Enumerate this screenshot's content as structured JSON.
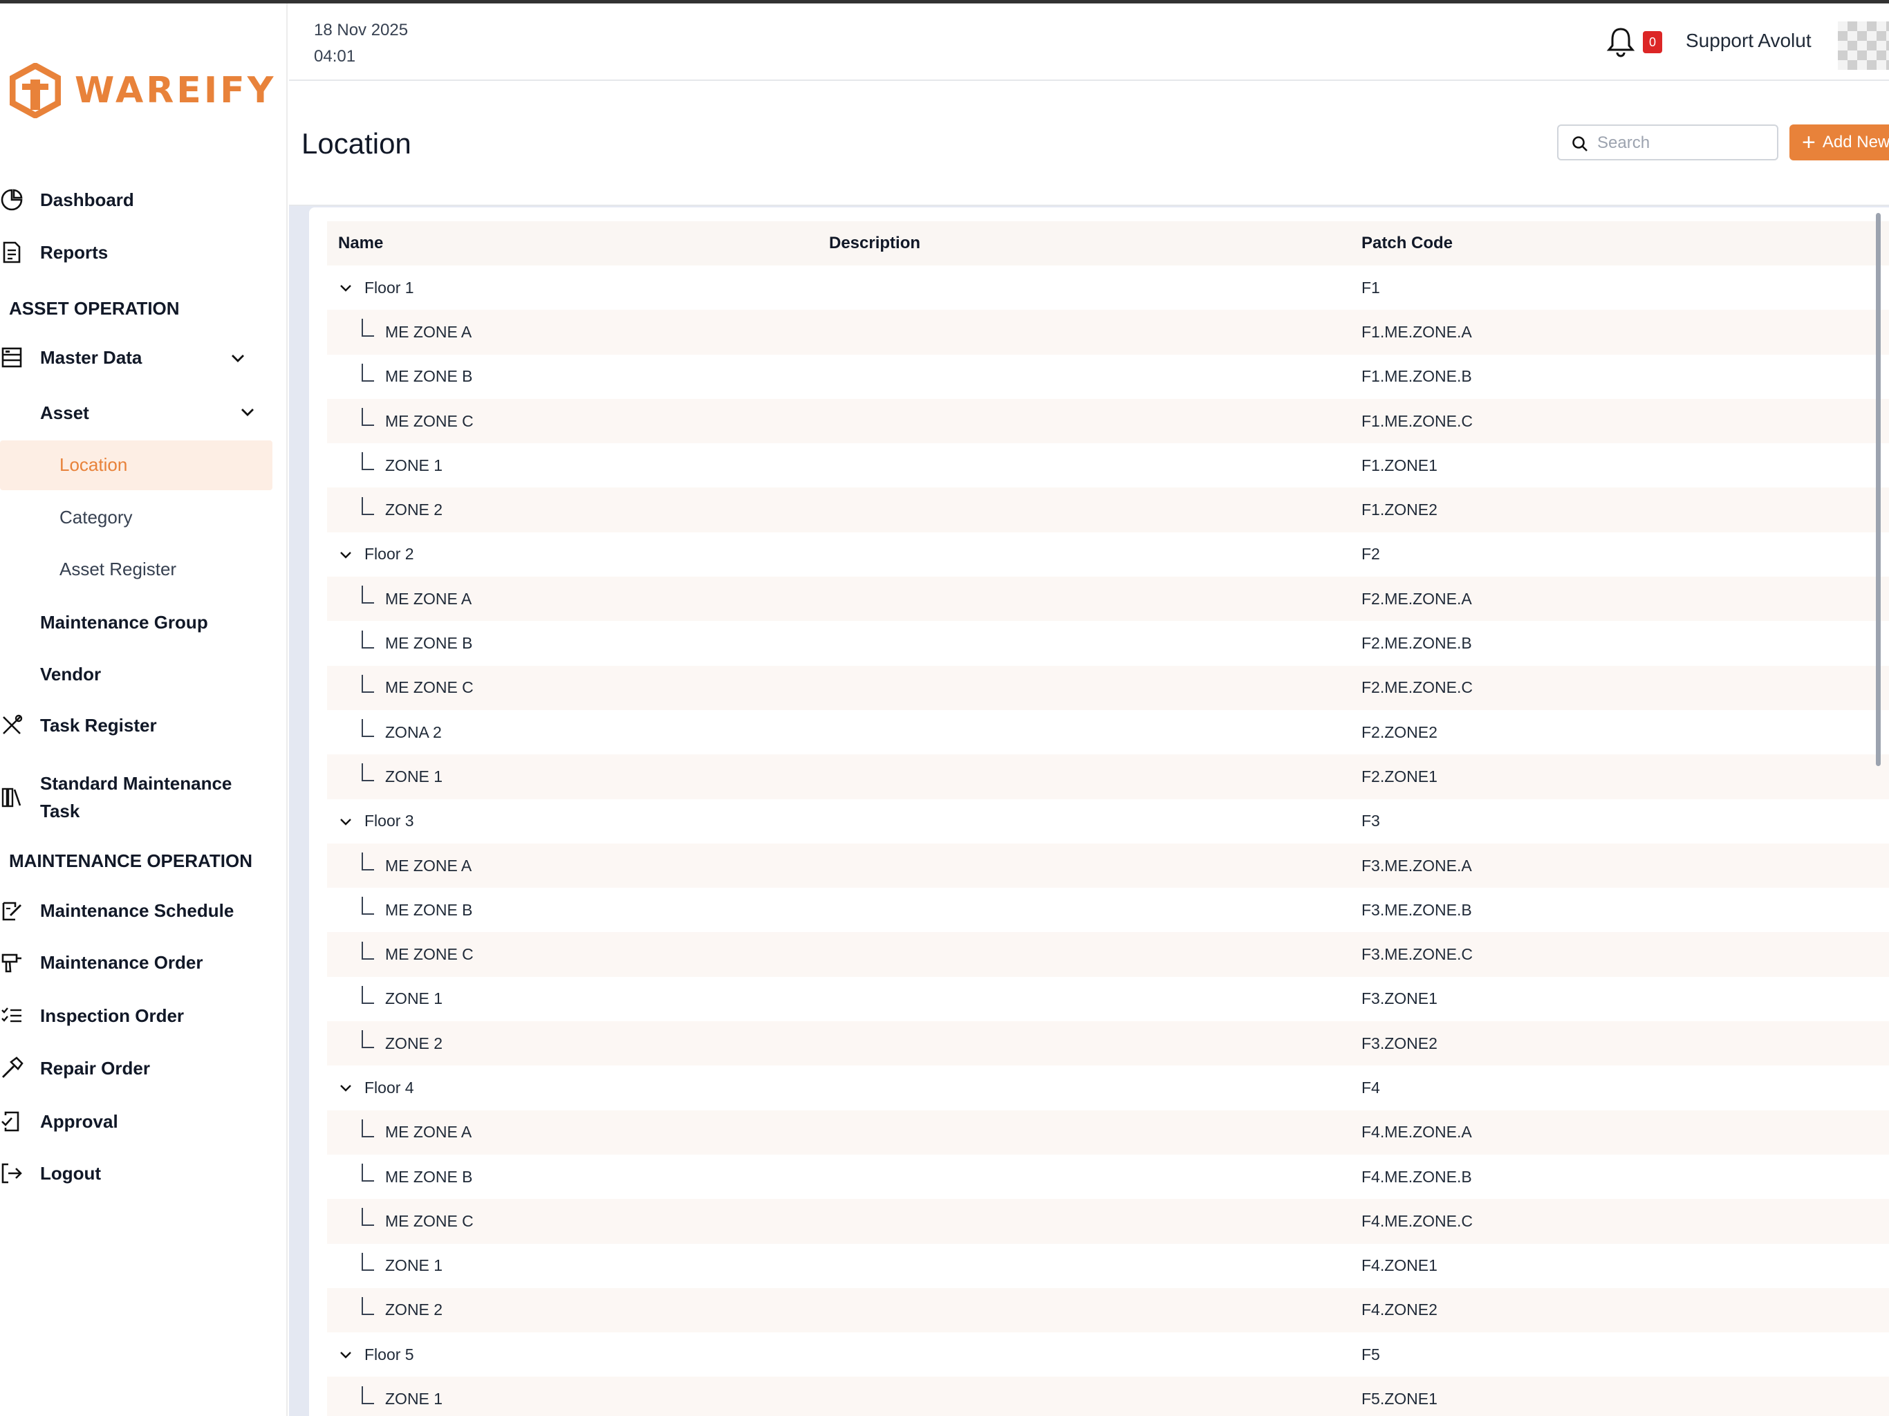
{
  "app": {
    "brand": "WAREIFY",
    "brand_color": "#e8823a"
  },
  "header": {
    "date": "18 Nov 2025",
    "time": "04:01",
    "notification_count": "0",
    "user_name": "Support Avolut"
  },
  "sidebar": {
    "dashboard": "Dashboard",
    "reports": "Reports",
    "section_asset": "ASSET OPERATION",
    "master_data": "Master Data",
    "asset": "Asset",
    "location": "Location",
    "category": "Category",
    "asset_register": "Asset Register",
    "maintenance_group": "Maintenance Group",
    "vendor": "Vendor",
    "task_register": "Task Register",
    "standard_task_line1": "Standard Maintenance",
    "standard_task_line2": "Task",
    "section_maintenance": "MAINTENANCE OPERATION",
    "maintenance_schedule": "Maintenance Schedule",
    "maintenance_order": "Maintenance Order",
    "inspection_order": "Inspection Order",
    "repair_order": "Repair Order",
    "approval": "Approval",
    "logout": "Logout"
  },
  "page": {
    "title": "Location",
    "search_placeholder": "Search",
    "add_label": "Add New"
  },
  "table": {
    "headers": {
      "name": "Name",
      "description": "Description",
      "patch_code": "Patch Code"
    },
    "rows": [
      {
        "name": "Floor 1",
        "desc": "",
        "code": "F1",
        "parent": true
      },
      {
        "name": "ME ZONE A",
        "desc": "",
        "code": "F1.ME.ZONE.A",
        "parent": false
      },
      {
        "name": "ME ZONE B",
        "desc": "",
        "code": "F1.ME.ZONE.B",
        "parent": false
      },
      {
        "name": "ME ZONE C",
        "desc": "",
        "code": "F1.ME.ZONE.C",
        "parent": false
      },
      {
        "name": "ZONE 1",
        "desc": "",
        "code": "F1.ZONE1",
        "parent": false
      },
      {
        "name": "ZONE 2",
        "desc": "",
        "code": "F1.ZONE2",
        "parent": false
      },
      {
        "name": "Floor 2",
        "desc": "",
        "code": "F2",
        "parent": true
      },
      {
        "name": "ME ZONE A",
        "desc": "",
        "code": "F2.ME.ZONE.A",
        "parent": false
      },
      {
        "name": "ME ZONE B",
        "desc": "",
        "code": "F2.ME.ZONE.B",
        "parent": false
      },
      {
        "name": "ME ZONE C",
        "desc": "",
        "code": "F2.ME.ZONE.C",
        "parent": false
      },
      {
        "name": "ZONA 2",
        "desc": "",
        "code": "F2.ZONE2",
        "parent": false
      },
      {
        "name": "ZONE 1",
        "desc": "",
        "code": "F2.ZONE1",
        "parent": false
      },
      {
        "name": "Floor 3",
        "desc": "",
        "code": "F3",
        "parent": true
      },
      {
        "name": "ME ZONE A",
        "desc": "",
        "code": "F3.ME.ZONE.A",
        "parent": false
      },
      {
        "name": "ME ZONE B",
        "desc": "",
        "code": "F3.ME.ZONE.B",
        "parent": false
      },
      {
        "name": "ME ZONE C",
        "desc": "",
        "code": "F3.ME.ZONE.C",
        "parent": false
      },
      {
        "name": "ZONE 1",
        "desc": "",
        "code": "F3.ZONE1",
        "parent": false
      },
      {
        "name": "ZONE 2",
        "desc": "",
        "code": "F3.ZONE2",
        "parent": false
      },
      {
        "name": "Floor 4",
        "desc": "",
        "code": "F4",
        "parent": true
      },
      {
        "name": "ME ZONE A",
        "desc": "",
        "code": "F4.ME.ZONE.A",
        "parent": false
      },
      {
        "name": "ME ZONE B",
        "desc": "",
        "code": "F4.ME.ZONE.B",
        "parent": false
      },
      {
        "name": "ME ZONE C",
        "desc": "",
        "code": "F4.ME.ZONE.C",
        "parent": false
      },
      {
        "name": "ZONE 1",
        "desc": "",
        "code": "F4.ZONE1",
        "parent": false
      },
      {
        "name": "ZONE 2",
        "desc": "",
        "code": "F4.ZONE2",
        "parent": false
      },
      {
        "name": "Floor 5",
        "desc": "",
        "code": "F5",
        "parent": true
      },
      {
        "name": "ZONE 1",
        "desc": "",
        "code": "F5.ZONE1",
        "parent": false
      }
    ]
  }
}
